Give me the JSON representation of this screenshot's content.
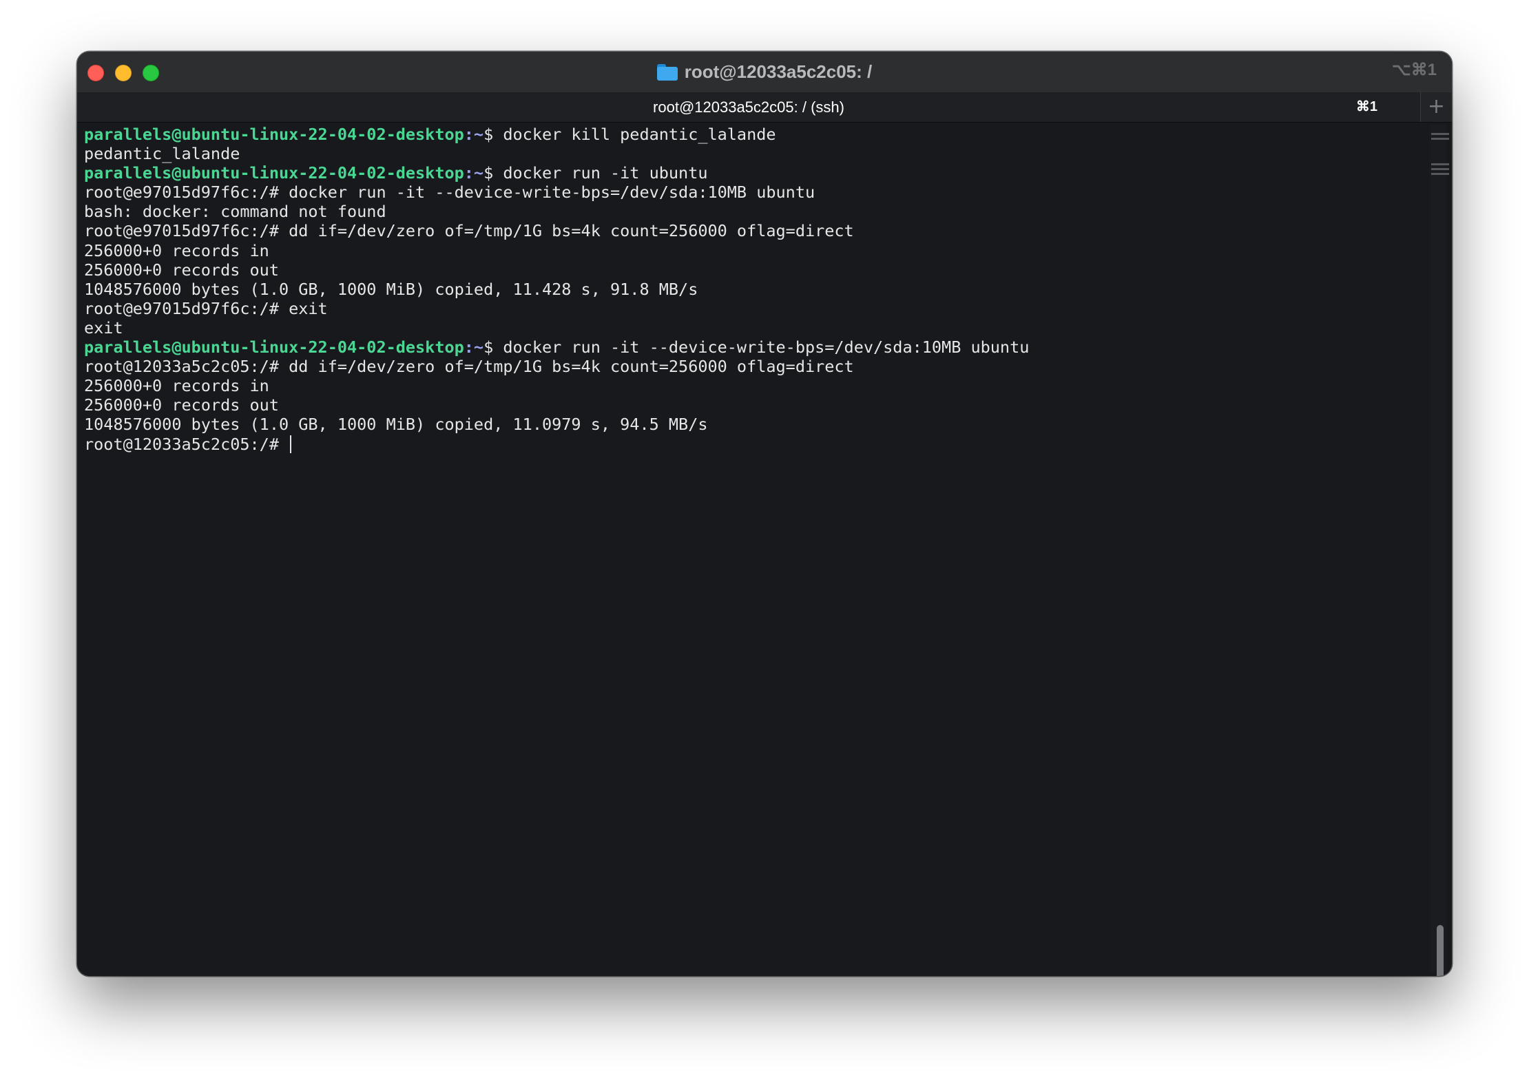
{
  "window": {
    "title": "root@12033a5c2c05: /",
    "title_shortcut": "⌥⌘1",
    "folder_icon": "folder-icon"
  },
  "tab": {
    "label": "root@12033a5c2c05: / (ssh)",
    "shortcut": "⌘1",
    "new_tab_symbol": "+"
  },
  "colors": {
    "prompt_user": "#4cd694",
    "prompt_path": "#9aa2f0",
    "text": "#e6e6e6",
    "background": "#17191d"
  },
  "terminal": {
    "lines": [
      {
        "user": "parallels@ubuntu-linux-22-04-02-desktop",
        "path": ":~",
        "text": "$ docker kill pedantic_lalande"
      },
      {
        "text": "pedantic_lalande"
      },
      {
        "user": "parallels@ubuntu-linux-22-04-02-desktop",
        "path": ":~",
        "text": "$ docker run -it ubuntu"
      },
      {
        "text": "root@e97015d97f6c:/# docker run -it --device-write-bps=/dev/sda:10MB ubuntu"
      },
      {
        "text": "bash: docker: command not found"
      },
      {
        "text": "root@e97015d97f6c:/# dd if=/dev/zero of=/tmp/1G bs=4k count=256000 oflag=direct"
      },
      {
        "text": "256000+0 records in"
      },
      {
        "text": "256000+0 records out"
      },
      {
        "text": "1048576000 bytes (1.0 GB, 1000 MiB) copied, 11.428 s, 91.8 MB/s"
      },
      {
        "text": "root@e97015d97f6c:/# exit"
      },
      {
        "text": "exit"
      },
      {
        "user": "parallels@ubuntu-linux-22-04-02-desktop",
        "path": ":~",
        "text": "$ docker run -it --device-write-bps=/dev/sda:10MB ubuntu"
      },
      {
        "text": "root@12033a5c2c05:/# dd if=/dev/zero of=/tmp/1G bs=4k count=256000 oflag=direct"
      },
      {
        "text": "256000+0 records in"
      },
      {
        "text": "256000+0 records out"
      },
      {
        "text": "1048576000 bytes (1.0 GB, 1000 MiB) copied, 11.0979 s, 94.5 MB/s"
      },
      {
        "text": "root@12033a5c2c05:/# ",
        "cursor": true
      }
    ]
  }
}
